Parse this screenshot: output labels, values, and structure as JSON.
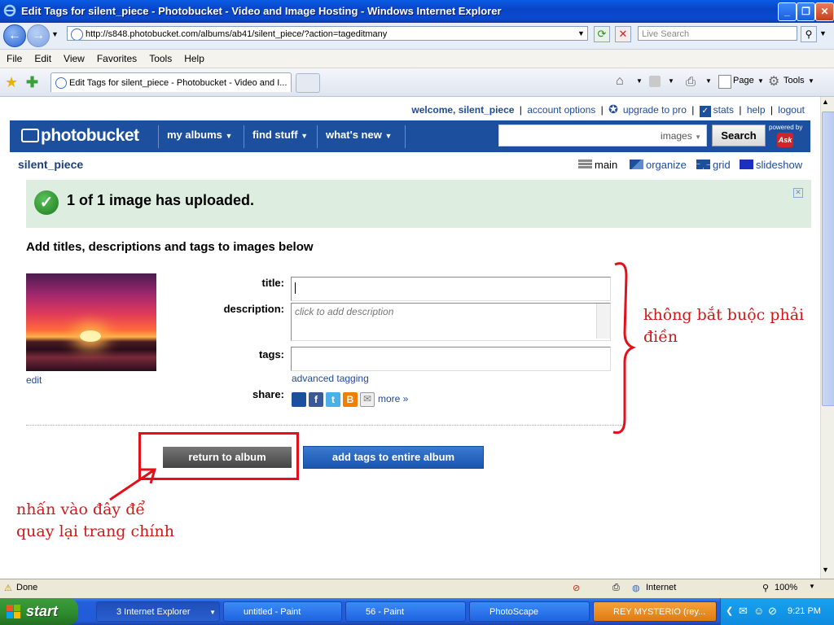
{
  "window": {
    "title": "Edit Tags for silent_piece - Photobucket - Video and Image Hosting - Windows Internet Explorer"
  },
  "addressbar": {
    "url": "http://s848.photobucket.com/albums/ab41/silent_piece/?action=tageditmany",
    "search_placeholder": "Live Search"
  },
  "menu": [
    "File",
    "Edit",
    "View",
    "Favorites",
    "Tools",
    "Help"
  ],
  "tab": {
    "label": "Edit Tags for silent_piece - Photobucket - Video and I..."
  },
  "commandbar": {
    "page_label": "Page",
    "tools_label": "Tools"
  },
  "site": {
    "toplinks": {
      "welcome": "welcome, silent_piece",
      "account_options": "account options",
      "upgrade": "upgrade to pro",
      "stats": "stats",
      "help": "help",
      "logout": "logout"
    },
    "logo": "photobucket",
    "nav": [
      "my albums",
      "find stuff",
      "what's new"
    ],
    "search_scope": "images",
    "search_button": "Search",
    "powered_by": "powered by",
    "ask_logo": "Ask",
    "username": "silent_piece",
    "views": [
      "main",
      "organize",
      "grid",
      "slideshow"
    ],
    "notice": "1 of 1 image has uploaded.",
    "heading": "Add titles, descriptions and tags to images below",
    "edit_link": "edit",
    "form": {
      "title_label": "title:",
      "description_label": "description:",
      "description_placeholder": "click to add description",
      "tags_label": "tags:",
      "advanced_tagging": "advanced tagging",
      "share_label": "share:",
      "more_link": "more »"
    },
    "return_button": "return to album",
    "add_tags_button": "add tags to entire album"
  },
  "annotations": {
    "optional_line1": "không bắt buộc phải",
    "optional_line2": "điền",
    "return_line1": "nhấn vào đây để",
    "return_line2": "quay lại trang chính"
  },
  "statusbar": {
    "status": "Done",
    "zone": "Internet",
    "zoom": "100%"
  },
  "taskbar": {
    "start": "start",
    "tasks": [
      "3 Internet Explorer",
      "untitled - Paint",
      "56 - Paint",
      "PhotoScape",
      "REY MYSTERIO (rey..."
    ],
    "clock": "9:21 PM"
  },
  "colors": {
    "photobucket_blue": "#1c4f9e",
    "notice_green": "#ddeee1",
    "annotation_red": "#e3101b"
  }
}
